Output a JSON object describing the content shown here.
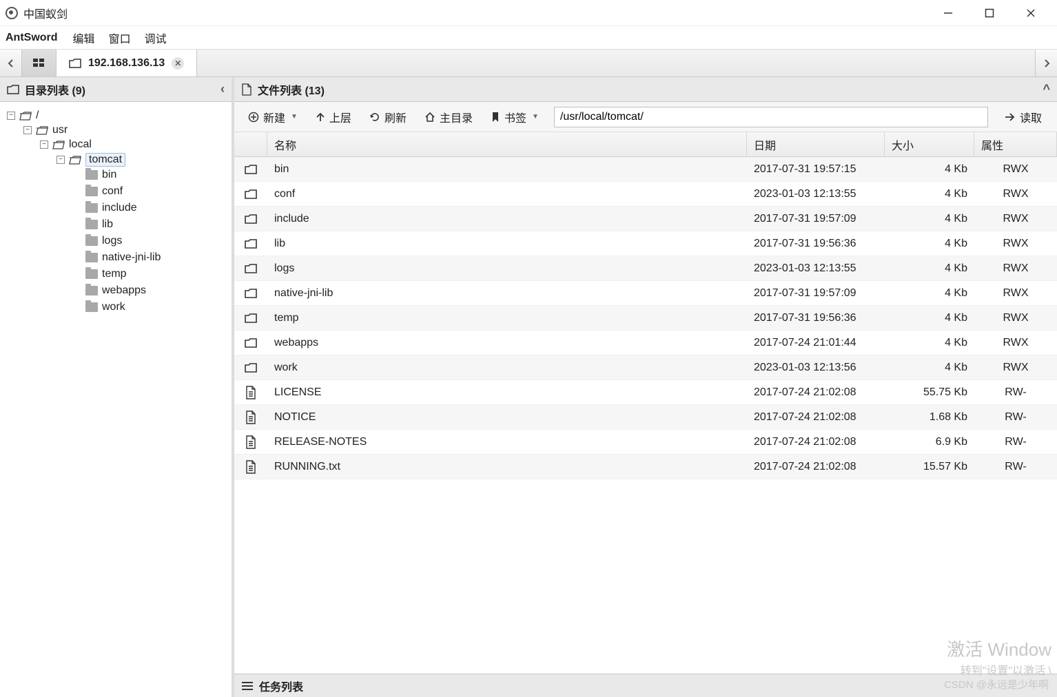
{
  "window": {
    "title": "中国蚁剑"
  },
  "menu": {
    "brand": "AntSword",
    "items": [
      "编辑",
      "窗口",
      "调试"
    ]
  },
  "tabs": {
    "active": {
      "label": "192.168.136.13"
    }
  },
  "left_panel": {
    "title": "目录列表 (9)",
    "tree": {
      "root": "/",
      "usr": "usr",
      "local": "local",
      "tomcat": "tomcat",
      "children": [
        "bin",
        "conf",
        "include",
        "lib",
        "logs",
        "native-jni-lib",
        "temp",
        "webapps",
        "work"
      ]
    }
  },
  "right_panel": {
    "title": "文件列表 (13)",
    "toolbar": {
      "new": "新建",
      "up": "上层",
      "refresh": "刷新",
      "home": "主目录",
      "bookmark": "书签",
      "read": "读取"
    },
    "path": "/usr/local/tomcat/",
    "columns": {
      "name": "名称",
      "date": "日期",
      "size": "大小",
      "attr": "属性"
    },
    "rows": [
      {
        "t": "d",
        "name": "bin",
        "date": "2017-07-31 19:57:15",
        "size": "4 Kb",
        "attr": "RWX"
      },
      {
        "t": "d",
        "name": "conf",
        "date": "2023-01-03 12:13:55",
        "size": "4 Kb",
        "attr": "RWX"
      },
      {
        "t": "d",
        "name": "include",
        "date": "2017-07-31 19:57:09",
        "size": "4 Kb",
        "attr": "RWX"
      },
      {
        "t": "d",
        "name": "lib",
        "date": "2017-07-31 19:56:36",
        "size": "4 Kb",
        "attr": "RWX"
      },
      {
        "t": "d",
        "name": "logs",
        "date": "2023-01-03 12:13:55",
        "size": "4 Kb",
        "attr": "RWX"
      },
      {
        "t": "d",
        "name": "native-jni-lib",
        "date": "2017-07-31 19:57:09",
        "size": "4 Kb",
        "attr": "RWX"
      },
      {
        "t": "d",
        "name": "temp",
        "date": "2017-07-31 19:56:36",
        "size": "4 Kb",
        "attr": "RWX"
      },
      {
        "t": "d",
        "name": "webapps",
        "date": "2017-07-24 21:01:44",
        "size": "4 Kb",
        "attr": "RWX"
      },
      {
        "t": "d",
        "name": "work",
        "date": "2023-01-03 12:13:56",
        "size": "4 Kb",
        "attr": "RWX"
      },
      {
        "t": "f",
        "name": "LICENSE",
        "date": "2017-07-24 21:02:08",
        "size": "55.75 Kb",
        "attr": "RW-"
      },
      {
        "t": "f",
        "name": "NOTICE",
        "date": "2017-07-24 21:02:08",
        "size": "1.68 Kb",
        "attr": "RW-"
      },
      {
        "t": "f",
        "name": "RELEASE-NOTES",
        "date": "2017-07-24 21:02:08",
        "size": "6.9 Kb",
        "attr": "RW-"
      },
      {
        "t": "f",
        "name": "RUNNING.txt",
        "date": "2017-07-24 21:02:08",
        "size": "15.57 Kb",
        "attr": "RW-"
      }
    ]
  },
  "taskbar": {
    "title": "任务列表"
  },
  "watermark": {
    "line1": "激活 Window",
    "line2": "转到\"设置\"以激活 \\"
  },
  "csdn": "CSDN @永远是少年啊"
}
